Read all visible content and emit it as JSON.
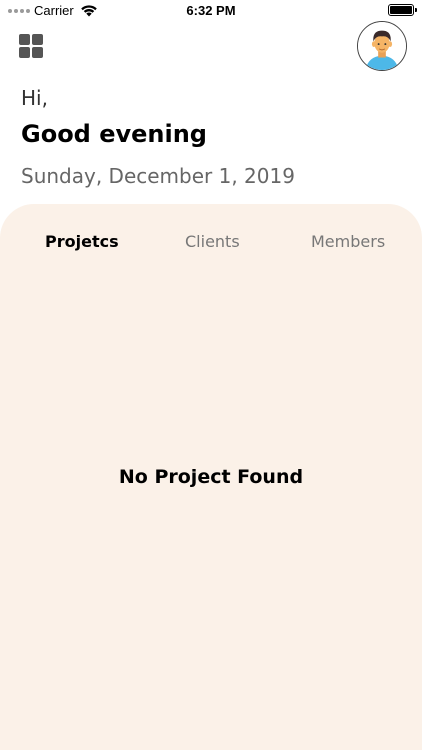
{
  "status_bar": {
    "carrier": "Carrier",
    "time": "6:32 PM",
    "battery_level": 1.0
  },
  "header": {
    "menu_icon": "grid-menu-icon",
    "avatar_icon": "user-avatar-icon",
    "greeting": "Hi,",
    "headline": "Good evening",
    "date": "Sunday, December 1, 2019"
  },
  "tabs": [
    {
      "label": "Projetcs",
      "active": true
    },
    {
      "label": "Clients",
      "active": false
    },
    {
      "label": "Members",
      "active": false
    }
  ],
  "empty_state": {
    "message": "No Project Found"
  },
  "colors": {
    "panel_background": "#fbf1e8",
    "avatar_shirt": "#4db8e8",
    "avatar_skin": "#f5b466",
    "avatar_hair": "#3a2a2a"
  }
}
